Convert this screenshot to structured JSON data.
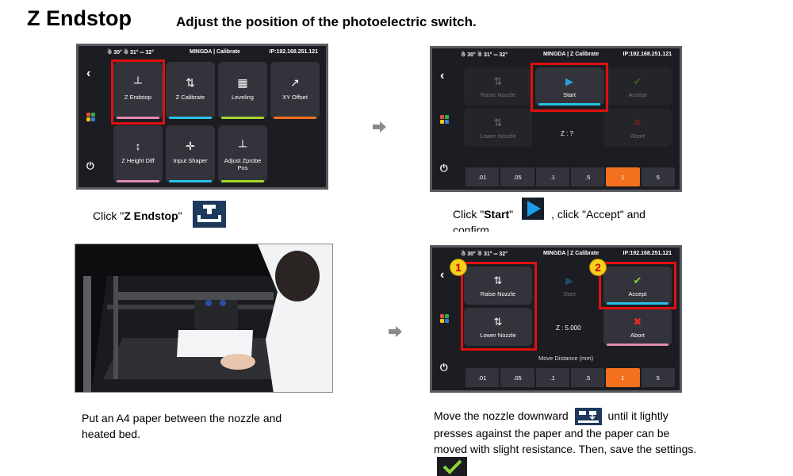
{
  "header": {
    "title": "Z Endstop",
    "subtitle": "Adjust the position of the photoelectric switch."
  },
  "status": {
    "temps": "☃ 30° ☃ 31° ═ 32°",
    "ip": "IP:192.168.251.121"
  },
  "screen1": {
    "mode": "MINGDA | Calibrate",
    "tiles": [
      {
        "label": "Z Endstop",
        "icon": "┴",
        "color": "#e48ab2"
      },
      {
        "label": "Z Calibrate",
        "icon": "⇅",
        "color": "#27c2e6"
      },
      {
        "label": "Leveling",
        "icon": "▦",
        "color": "#a6d62c"
      },
      {
        "label": "XY Offset",
        "icon": "↗",
        "color": "#f2701e"
      },
      {
        "label": "Z Height Diff",
        "icon": "↕",
        "color": "#e48ab2"
      },
      {
        "label": "Input Shaper",
        "icon": "✛",
        "color": "#27c2e6"
      },
      {
        "label": "Adjust Zprobe Pos",
        "icon": "┴",
        "color": "#a6d62c"
      }
    ]
  },
  "screen2": {
    "mode": "MINGDA | Z Calibrate",
    "raise": "Raise Nozzle",
    "start": "Start",
    "accept": "Accept",
    "lower": "Lower Nozzle",
    "z": "Z : ?",
    "abort": "Abort"
  },
  "screen3": {
    "mode": "MINGDA | Z Calibrate",
    "raise": "Raise Nozzle",
    "start": "Start",
    "accept": "Accept",
    "lower": "Lower Nozzle",
    "z": "Z : 5.000",
    "abort": "Abort",
    "move_distance": "Move Distance (mm)",
    "badge1": "1",
    "badge2": "2"
  },
  "distances": [
    ".01",
    ".05",
    ".1",
    ".5",
    "1",
    "5"
  ],
  "active_distance": "1",
  "captions": {
    "step1_pre": "Click \"",
    "step1_bold": "Z Endstop",
    "step1_post": "\"",
    "step2_pre": "Click \"",
    "step2_bold": "Start",
    "step2_mid": "\"",
    "step2_post": ", click \"Accept\" and",
    "step2_cut": "confirm",
    "step3": "Put an A4 paper between the nozzle and heated bed.",
    "step4": "Move the nozzle downward",
    "step4_rest": "until it lightly presses against the paper and the paper can be moved with slight resistance. Then, save the settings."
  }
}
